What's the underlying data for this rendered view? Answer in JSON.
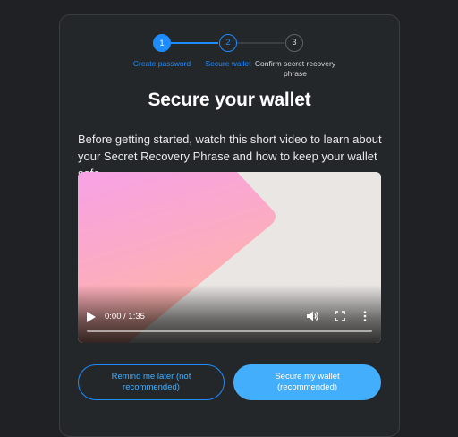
{
  "stepper": {
    "steps": [
      {
        "number": "1",
        "label": "Create password",
        "state": "complete"
      },
      {
        "number": "2",
        "label": "Secure wallet",
        "state": "active"
      },
      {
        "number": "3",
        "label": "Confirm secret recovery phrase",
        "state": "pending"
      }
    ]
  },
  "main": {
    "title": "Secure your wallet",
    "description": "Before getting started, watch this short video to learn about your Secret Recovery Phrase and how to keep your wallet safe."
  },
  "video": {
    "time": "0:00 / 1:35",
    "progress": 0,
    "icons": {
      "play": "play-icon",
      "volume": "volume-icon",
      "fullscreen": "fullscreen-icon",
      "more": "more-vertical-icon"
    }
  },
  "actions": {
    "remind_label": "Remind me later (not recommended)",
    "secure_label": "Secure my wallet (recommended)"
  },
  "colors": {
    "accent": "#1c8cfe",
    "primary_button": "#43aefc",
    "background": "#202124",
    "card": "#24272a"
  }
}
